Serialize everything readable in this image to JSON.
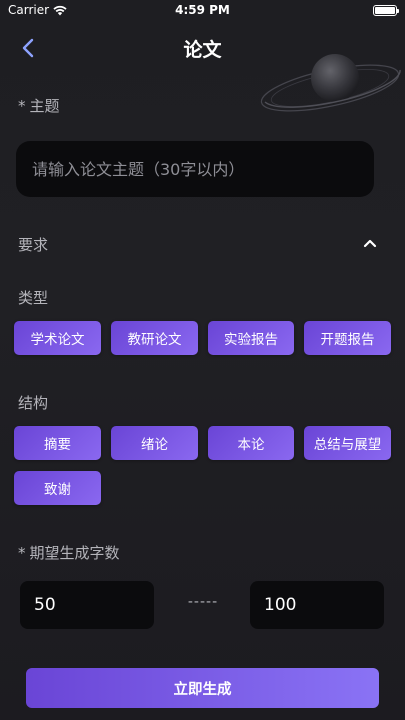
{
  "status_bar": {
    "carrier": "Carrier",
    "time": "4:59 PM",
    "battery_level": 1.0
  },
  "nav": {
    "title": "论文",
    "back_icon": "chevron-left-icon",
    "accent_color": "#8ea3ff"
  },
  "topic": {
    "required_mark": "*",
    "label": "主题",
    "placeholder": "请输入论文主题（30字以内）",
    "value": ""
  },
  "requirements": {
    "label": "要求",
    "expanded": true,
    "toggle_icon": "chevron-up-icon"
  },
  "type_section": {
    "label": "类型",
    "options": [
      "学术论文",
      "教研论文",
      "实验报告",
      "开题报告"
    ]
  },
  "structure_section": {
    "label": "结构",
    "options": [
      "摘要",
      "绪论",
      "本论",
      "总结与展望",
      "致谢"
    ]
  },
  "word_count": {
    "required_mark": "*",
    "label": "期望生成字数",
    "min_value": "50",
    "separator": "-----",
    "max_value": "100"
  },
  "generate_button": {
    "label": "立即生成"
  },
  "colors": {
    "background": "#1e1e22",
    "chip_start": "#6a45d6",
    "chip_end": "#8a68f0",
    "input_background": "#0b0b0d"
  }
}
